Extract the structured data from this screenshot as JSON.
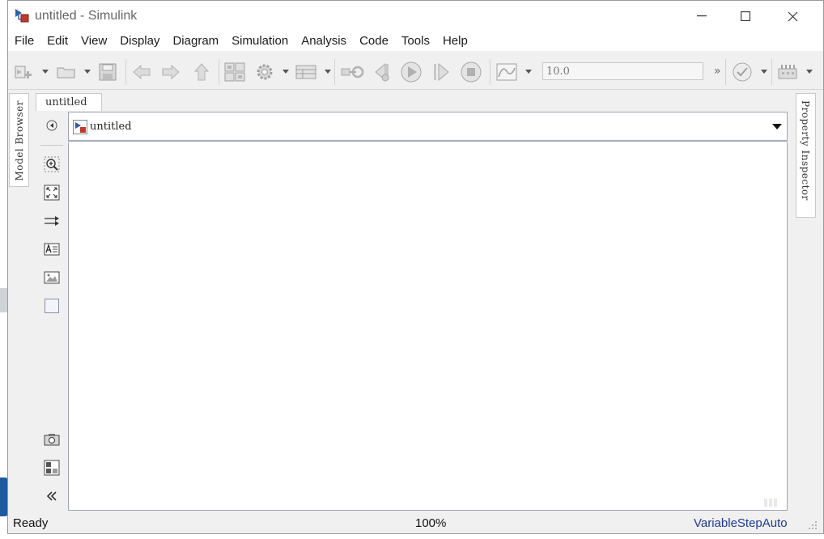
{
  "window": {
    "title": "untitled - Simulink",
    "minimize_glyph": "—",
    "maximize_glyph": "☐",
    "close_glyph": "✕"
  },
  "menu": {
    "items": [
      "File",
      "Edit",
      "View",
      "Display",
      "Diagram",
      "Simulation",
      "Analysis",
      "Code",
      "Tools",
      "Help"
    ]
  },
  "toolbar": {
    "stop_time": "10.0",
    "more_glyph": "»",
    "icons": [
      "new-model-icon",
      "open-folder-icon",
      "save-icon",
      "back-arrow-icon",
      "forward-arrow-icon",
      "up-arrow-icon",
      "library-browser-icon",
      "model-settings-gear-icon",
      "model-explorer-icon",
      "update-diagram-icon",
      "step-back-icon",
      "run-icon",
      "step-forward-icon",
      "stop-icon",
      "data-inspector-icon",
      "model-advisor-check-icon",
      "build-model-icon"
    ]
  },
  "panels": {
    "model_browser": "Model Browser",
    "property_inspector": "Property Inspector"
  },
  "editor": {
    "tab_label": "untitled",
    "breadcrumb_label": "untitled"
  },
  "palette": {
    "icons": [
      "hide-browser-icon",
      "zoom-icon",
      "fit-to-view-icon",
      "signal-lines-icon",
      "annotation-icon",
      "image-icon",
      "area-icon",
      "screenshot-icon",
      "block-icon",
      "collapse-palette-icon"
    ]
  },
  "status": {
    "state": "Ready",
    "zoom": "100%",
    "solver": "VariableStepAuto"
  },
  "colors": {
    "window_bg": "#f0f0f0",
    "canvas_bg": "#ffffff",
    "solver_text": "#1f3a93",
    "model_icon_red": "#c0392b",
    "model_icon_blue": "#2d5fa8"
  }
}
